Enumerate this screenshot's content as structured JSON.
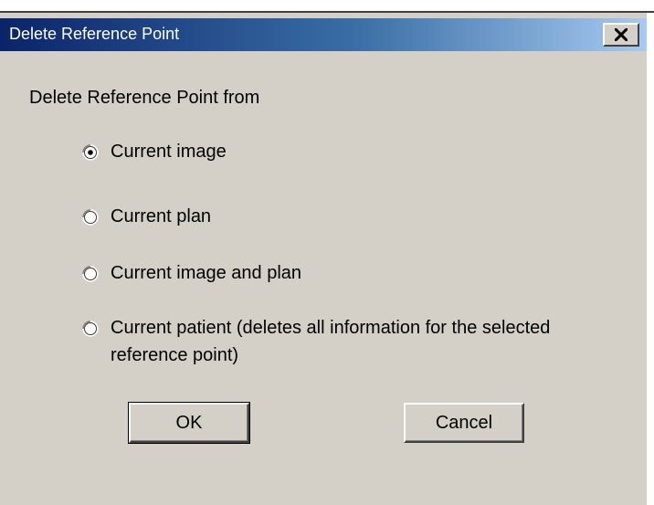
{
  "dialog": {
    "title": "Delete Reference Point",
    "close_glyph": "✕",
    "group_label": "Delete Reference Point from",
    "options": [
      {
        "label": "Current image",
        "selected": true
      },
      {
        "label": "Current plan",
        "selected": false
      },
      {
        "label": "Current image and plan",
        "selected": false
      },
      {
        "label": "Current patient (deletes all information for the selected reference point)",
        "selected": false
      }
    ],
    "buttons": {
      "ok": "OK",
      "cancel": "Cancel"
    }
  },
  "colors": {
    "face": "#d4d0c8",
    "title_start": "#0a246a",
    "title_end": "#a6caf0"
  },
  "icons": {
    "close": "close-icon",
    "radio_selected": "radio-selected-icon",
    "radio_unselected": "radio-unselected-icon"
  }
}
